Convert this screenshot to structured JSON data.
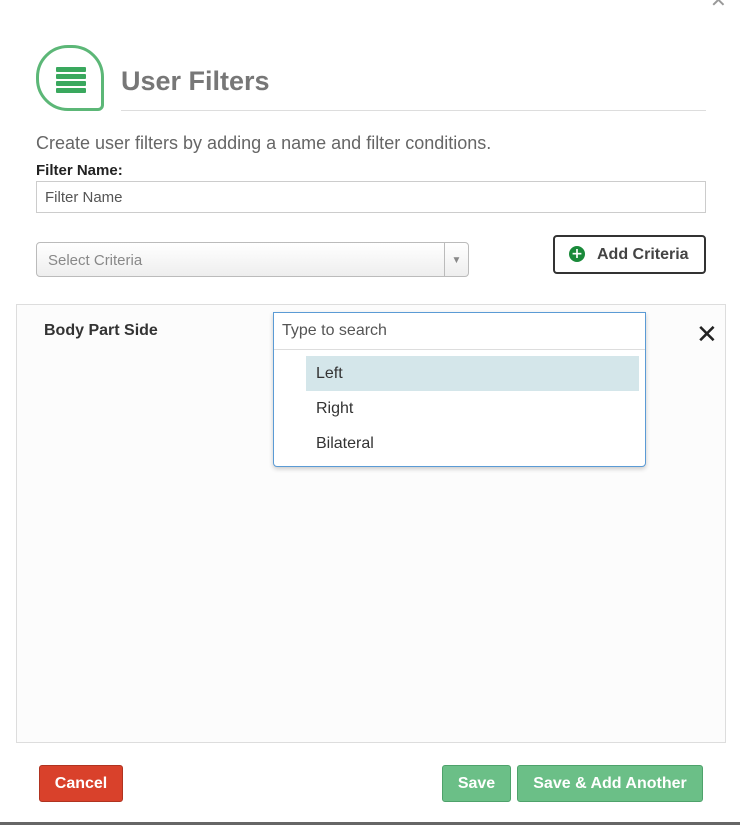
{
  "header": {
    "title": "User Filters",
    "icon": "list-icon",
    "accent_color": "#5cb777"
  },
  "form": {
    "instructions": "Create user filters by adding a name and filter conditions.",
    "filter_name_label": "Filter Name:",
    "filter_name_placeholder": "Filter Name",
    "criteria_select_placeholder": "Select Criteria",
    "add_criteria_label": "Add Criteria"
  },
  "criteria": {
    "label": "Body Part Side",
    "search_placeholder": "Type to search",
    "options": [
      "Left",
      "Right",
      "Bilateral"
    ],
    "highlighted_option": "Left"
  },
  "footer": {
    "cancel_label": "Cancel",
    "save_label": "Save",
    "save_add_label": "Save & Add Another",
    "cancel_color": "#d9412b",
    "save_color": "#6bbf87"
  }
}
